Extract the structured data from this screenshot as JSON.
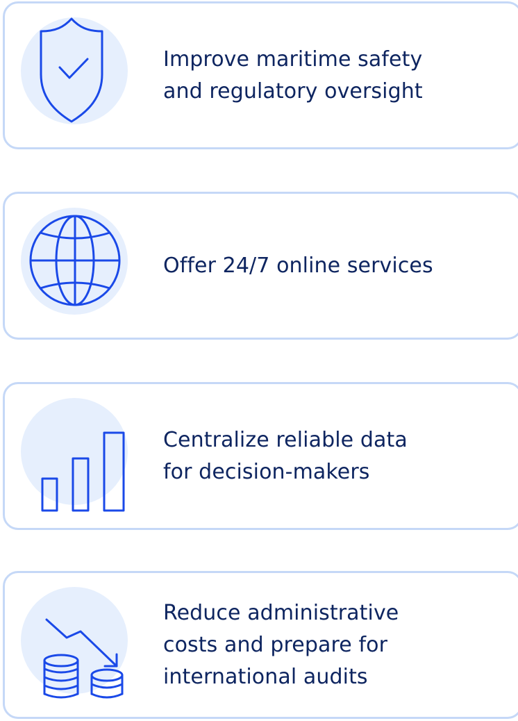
{
  "colors": {
    "text": "#0e2560",
    "icon_stroke": "#1a49e8",
    "icon_bg": "#e6effd",
    "card_border": "#c5d8f7"
  },
  "cards": [
    {
      "icon": "shield-check-icon",
      "lines": [
        "Improve maritime safety",
        "and regulatory oversight"
      ]
    },
    {
      "icon": "globe-icon",
      "lines": [
        "Offer 24/7 online services"
      ]
    },
    {
      "icon": "bar-chart-icon",
      "lines": [
        "Centralize reliable data",
        "for decision-makers"
      ]
    },
    {
      "icon": "coins-down-trend-icon",
      "lines": [
        "Reduce administrative",
        "costs and prepare for",
        "international audits"
      ]
    }
  ]
}
